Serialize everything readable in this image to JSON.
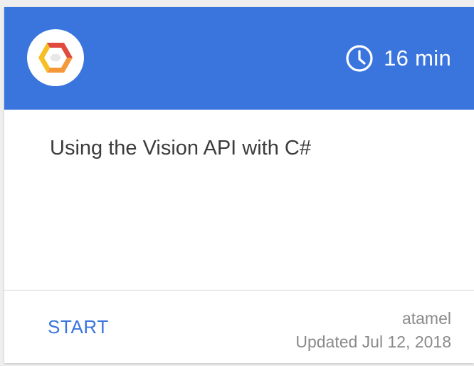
{
  "card": {
    "duration": "16 min",
    "title": "Using the Vision API with C#",
    "start_label": "START",
    "author": "atamel",
    "updated": "Updated Jul 12, 2018"
  },
  "colors": {
    "header_bg": "#3a75de",
    "accent": "#3a75de",
    "logo_yellow": "#f6bf26",
    "logo_red": "#e04a3f",
    "logo_orange": "#f4983a"
  },
  "icons": {
    "logo": "google-cloud-logo-icon",
    "duration": "clock-icon"
  }
}
